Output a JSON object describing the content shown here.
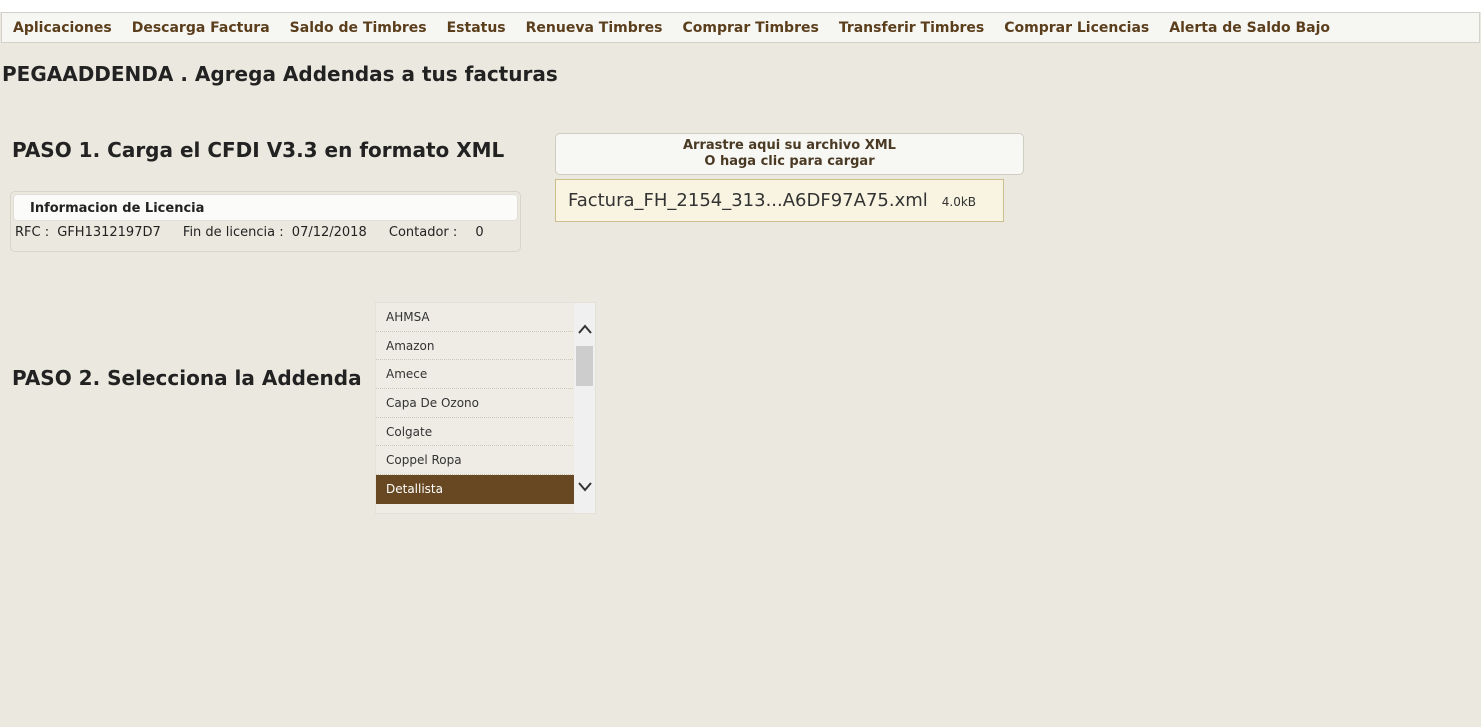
{
  "menu": {
    "items": [
      "Aplicaciones",
      "Descarga Factura",
      "Saldo de Timbres",
      "Estatus",
      "Renueva Timbres",
      "Comprar Timbres",
      "Transferir Timbres",
      "Comprar Licencias",
      "Alerta de Saldo Bajo"
    ]
  },
  "page_title": "PEGAADDENDA . Agrega Addendas a tus facturas",
  "step1": {
    "title": "PASO 1. Carga el CFDI V3.3 en formato XML"
  },
  "license": {
    "header": "Informacion de Licencia",
    "rfc_label": "RFC :",
    "rfc_value": "GFH1312197D7",
    "expiry_label": "Fin de licencia :",
    "expiry_value": "07/12/2018",
    "counter_label": "Contador :",
    "counter_value": "0"
  },
  "dropzone": {
    "line1": "Arrastre aqui su archivo XML",
    "line2": "O haga clic para cargar"
  },
  "uploaded_file": {
    "name": "Factura_FH_2154_313...A6DF97A75.xml",
    "size": "4.0kB"
  },
  "step2": {
    "title": "PASO 2. Selecciona la Addenda"
  },
  "addenda_list": {
    "items": [
      "AHMSA",
      "Amazon",
      "Amece",
      "Capa De Ozono",
      "Colgate",
      "Coppel Ropa",
      "Detallista"
    ],
    "selected": "Detallista"
  },
  "colors": {
    "background": "#ebe9df",
    "menu_text": "#5b3e1c",
    "selected_item": "#674822",
    "file_chip_bg": "#f8f4e1"
  },
  "icons": {
    "scroll_up": "chevron-up-icon",
    "scroll_down": "chevron-down-icon"
  }
}
